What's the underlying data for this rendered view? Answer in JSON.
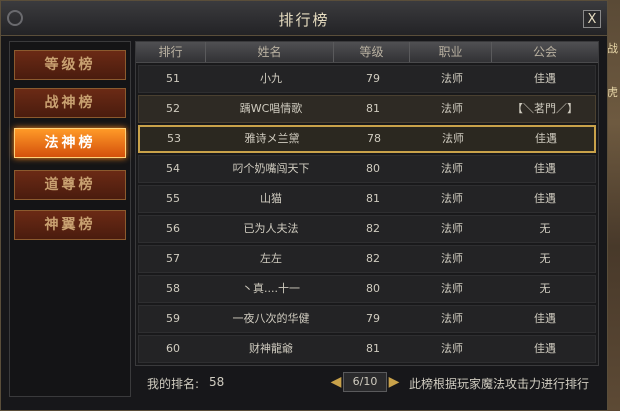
{
  "window": {
    "title": "排行榜",
    "close_label": "X"
  },
  "sidebar": {
    "items": [
      {
        "label": "等级榜",
        "active": false
      },
      {
        "label": "战神榜",
        "active": false
      },
      {
        "label": "法神榜",
        "active": true
      },
      {
        "label": "道尊榜",
        "active": false
      },
      {
        "label": "神翼榜",
        "active": false
      }
    ]
  },
  "table": {
    "headers": [
      "排行",
      "姓名",
      "等级",
      "职业",
      "公会"
    ],
    "rows": [
      {
        "rank": "51",
        "name": "小九",
        "level": "79",
        "class": "法师",
        "guild": "佳遇"
      },
      {
        "rank": "52",
        "name": "踽WC唱情歌",
        "level": "81",
        "class": "法师",
        "guild": "【＼茗門／】"
      },
      {
        "rank": "53",
        "name": "雅诗メ兰黛",
        "level": "78",
        "class": "法师",
        "guild": "佳遇"
      },
      {
        "rank": "54",
        "name": "叼个奶嘴闯天下",
        "level": "80",
        "class": "法师",
        "guild": "佳遇"
      },
      {
        "rank": "55",
        "name": "山猫",
        "level": "81",
        "class": "法师",
        "guild": "佳遇"
      },
      {
        "rank": "56",
        "name": "已为人夫法",
        "level": "82",
        "class": "法师",
        "guild": "无"
      },
      {
        "rank": "57",
        "name": "左左",
        "level": "82",
        "class": "法师",
        "guild": "无"
      },
      {
        "rank": "58",
        "name": "丶真....十一",
        "level": "80",
        "class": "法师",
        "guild": "无"
      },
      {
        "rank": "59",
        "name": "一夜八次的华健",
        "level": "79",
        "class": "法师",
        "guild": "佳遇"
      },
      {
        "rank": "60",
        "name": "财神龍爺",
        "level": "81",
        "class": "法师",
        "guild": "佳遇"
      }
    ],
    "highlighted_row_index": 1,
    "selected_row_index": 2
  },
  "footer": {
    "my_rank_label": "我的排名:",
    "my_rank_value": "58",
    "page_indicator": "6/10",
    "note": "此榜根据玩家魔法攻击力进行排行"
  },
  "scene": {
    "edge_glyphs": [
      "战",
      "虎"
    ]
  },
  "colors": {
    "accent": "#c9a24a",
    "active_tab": "#ff8a1e",
    "text": "#d0ccc0"
  },
  "icons": {
    "prev": "triangle-left-icon",
    "next": "triangle-right-icon",
    "close": "close-icon",
    "ornament": "ring-ornament-icon"
  }
}
